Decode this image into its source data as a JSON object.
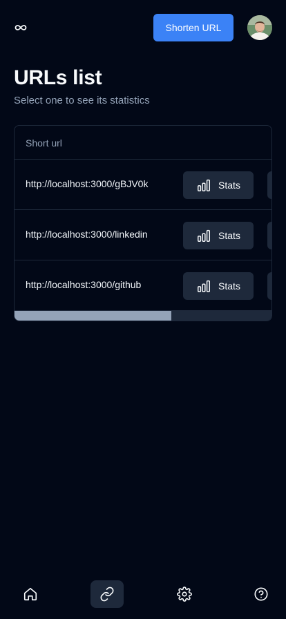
{
  "header": {
    "logo_icon": "infinity-icon",
    "shorten_button": "Shorten URL",
    "avatar_icon": "user-avatar"
  },
  "page": {
    "title": "URLs list",
    "subtitle": "Select one to see its statistics"
  },
  "table": {
    "column_header": "Short url",
    "rows": [
      {
        "url": "http://localhost:3000/gBJV0k",
        "action_label": "Stats",
        "action_icon": "bar-chart-icon"
      },
      {
        "url": "http://localhost:3000/linkedin",
        "action_label": "Stats",
        "action_icon": "bar-chart-icon"
      },
      {
        "url": "http://localhost:3000/github",
        "action_label": "Stats",
        "action_icon": "bar-chart-icon"
      }
    ],
    "horizontal_scroll_position": 0,
    "horizontal_scroll_visible_fraction": 0.61
  },
  "bottom_nav": {
    "items": [
      {
        "icon": "home-icon",
        "active": false
      },
      {
        "icon": "link-icon",
        "active": true
      },
      {
        "icon": "gear-icon",
        "active": false
      },
      {
        "icon": "help-circle-icon",
        "active": false
      }
    ]
  },
  "colors": {
    "background": "#020817",
    "accent": "#3b82f6",
    "muted_text": "#94a3b8",
    "border": "#1e293b"
  }
}
